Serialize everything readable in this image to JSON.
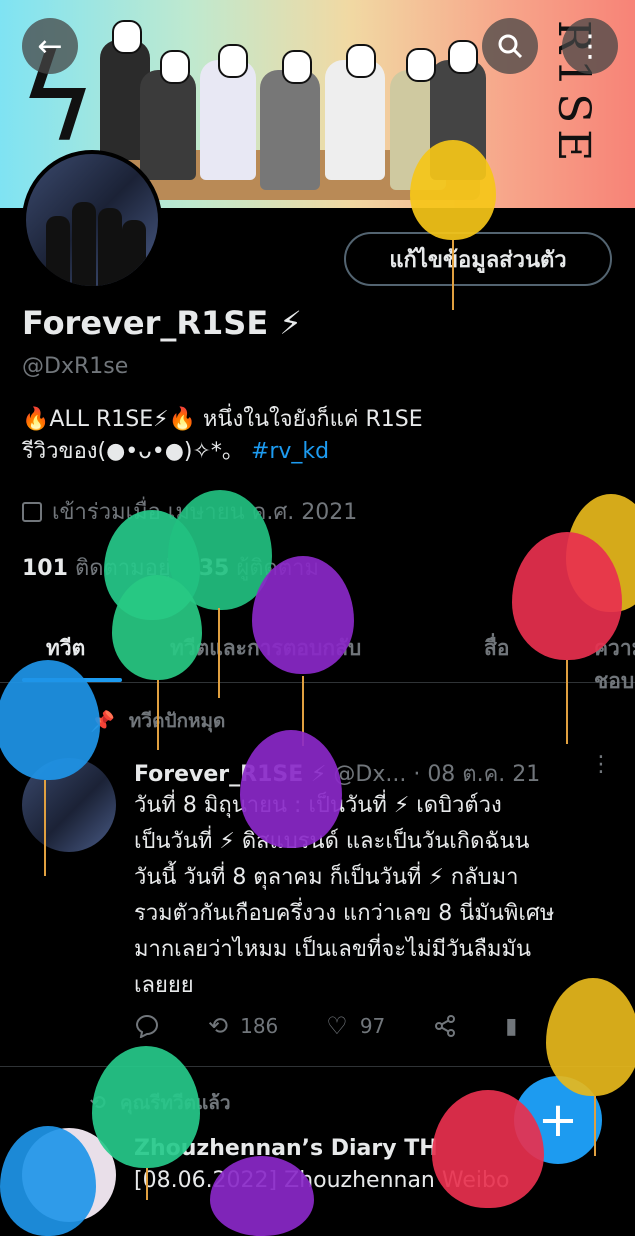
{
  "header": {
    "back_icon": "arrow-left-icon",
    "search_icon": "search-icon",
    "more_icon": "more-vertical-icon",
    "banner_text": "R1SE"
  },
  "profile": {
    "edit_button": "แก้ไขข้อมูลส่วนตัว",
    "display_name": "Forever_R1SE ⚡",
    "handle": "@DxR1se",
    "bio_line1": "🔥ALL R1SE⚡🔥 หนึ่งในใจยังก็แค่ R1SE",
    "bio_line2": "รีวิวของ(●•ᴗ•●)✧*。",
    "bio_hashtag": "#rv_kd",
    "joined": "เข้าร่วมเมื่อ เมษายน ค.ศ. 2021",
    "following_count": "101",
    "following_label": "ติดตามอยู่",
    "followers_count": "35",
    "followers_label": "ผู้ติดตาม"
  },
  "tabs": [
    "ทวีต",
    "ทวีตและการตอบกลับ",
    "สื่อ",
    "ความชอบ"
  ],
  "pinned_tweet": {
    "pinned_label": "ทวีตปักหมุด",
    "author": "Forever_R1SE ⚡",
    "handle": "@Dx...",
    "date": "· 08 ต.ค. 21",
    "lines": [
      "วันที่ 8 มิถุนายน : เป็นวันที่ ⚡ เดบิวต์วง",
      "เป็นวันที่ ⚡ ดิสแบรนด์ และเป็นวันเกิดฉันน",
      "วันนี้ วันที่ 8 ตุลาคม  ก็เป็นวันที่ ⚡ กลับมา",
      "รวมตัวกันเกือบครึ่งวง แกว่าเลข 8 นี่มันพิเศษ",
      "มากเลยว่าไหมม เป็นเลขที่จะไม่มีวันลืมมัน",
      "เลยยย"
    ],
    "retweets": "186",
    "likes": "97"
  },
  "next_tweet": {
    "retweeted_label": "คุณรีทวีตแล้ว",
    "author": "Zhouzhennan’s Diary TH",
    "text": "[08.06.2022] Zhouzhennan Weibo"
  },
  "fab_label": "+",
  "colors": {
    "accent": "#1d9bf0",
    "background": "#000000",
    "muted": "#71767b"
  }
}
